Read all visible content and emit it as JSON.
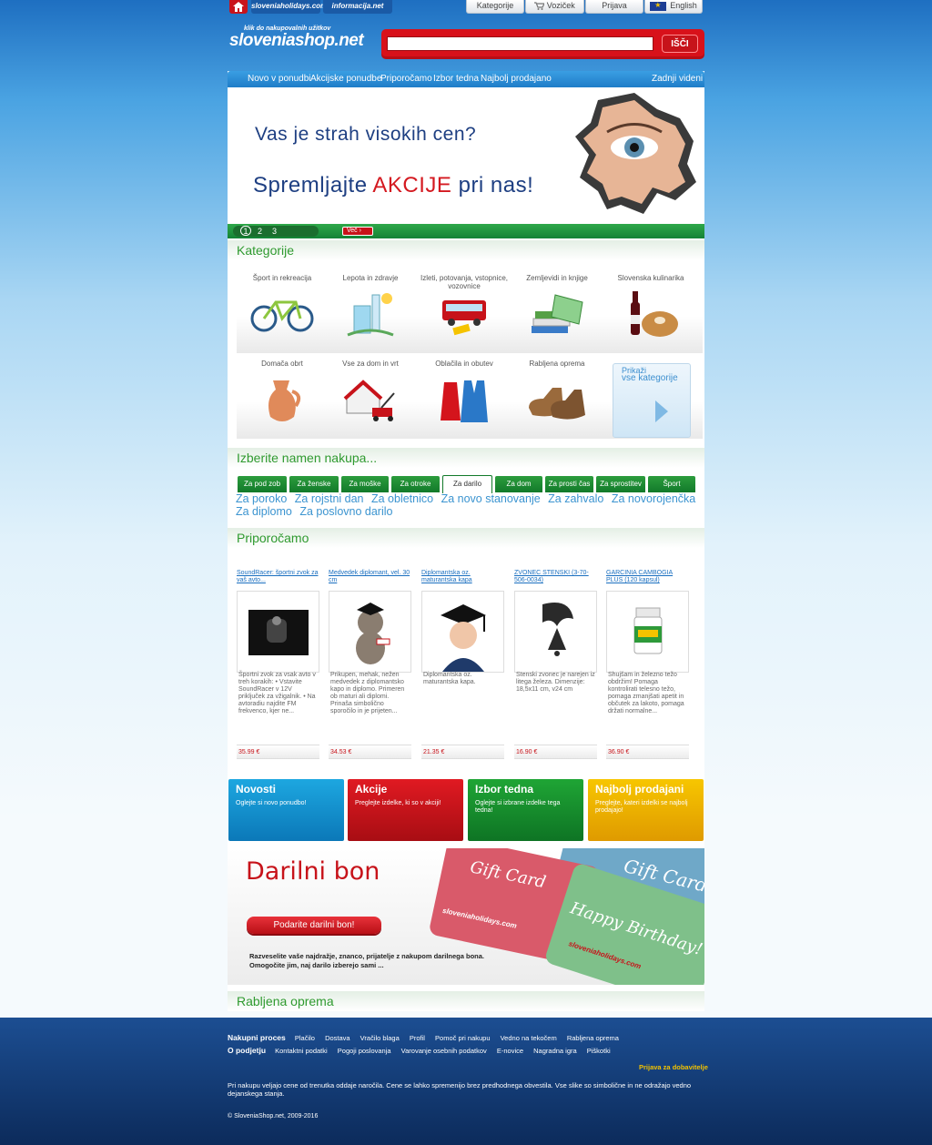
{
  "colors": {
    "brand_blue": "#1e6fc1",
    "accent_red": "#d8111a",
    "green": "#2f9a2f"
  },
  "topbar": {
    "home_icon": "house-icon",
    "site_tabs": [
      "sloveniaholidays.com",
      "informacija.net"
    ],
    "user_tabs": [
      {
        "label": "Kategorije"
      },
      {
        "label": "Voziček",
        "icon": "cart-icon"
      },
      {
        "label": "Prijava"
      },
      {
        "label": "English",
        "icon": "eu-flag-icon"
      }
    ]
  },
  "logo": {
    "tagline": "klik do nakupovalnih užitkov",
    "name": "sloveniashop.net"
  },
  "search": {
    "value": "",
    "button": "IŠČI"
  },
  "nav": {
    "items": [
      "Novo v ponudbi",
      "Akcijske ponudbe",
      "Priporočamo",
      "Izbor tedna",
      "Najbolj prodajano"
    ],
    "right": "Zadnji videni"
  },
  "banner": {
    "line1": "Vas je strah visokih cen?",
    "line2_a": "Spremljajte ",
    "line2_b": "AKCIJE",
    "line2_c": " pri nas!",
    "pages": [
      "1",
      "2",
      "3"
    ],
    "more": "Več"
  },
  "categories": {
    "title": "Kategorije",
    "items": [
      "Šport in rekreacija",
      "Lepota in zdravje",
      "Izleti, potovanja, vstopnice, vozovnice",
      "Zemljevidi in knjige",
      "Slovenska kulinarika",
      "Domača obrt",
      "Vse za dom in vrt",
      "Oblačila in obutev",
      "Rabljena oprema"
    ],
    "show_all_1": "Prikaži",
    "show_all_2": "vse kategorije"
  },
  "purpose": {
    "title": "Izberite namen nakupa...",
    "tabs": [
      "Za pod zob",
      "Za ženske",
      "Za moške",
      "Za otroke",
      "Za darilo",
      "Za dom",
      "Za prosti čas",
      "Za sprostitev",
      "Šport"
    ],
    "links": [
      "Za poroko",
      "Za rojstni dan",
      "Za obletnico",
      "Za novo stanovanje",
      "Za zahvalo",
      "Za novorojenčka",
      "Za diplomo",
      "Za poslovno darilo"
    ]
  },
  "recommend": {
    "title": "Priporočamo",
    "products": [
      {
        "title": "SoundRacer: športni zvok za vaš avto...",
        "desc": "Športni zvok za vsak avto v treh korakih: • Vstavite SoundRacer v 12V priključek za vžigalnik. • Na avtoradiu najdite FM frekvenco, kjer ne...",
        "price": "35.99 €"
      },
      {
        "title": "Medvedek diplomant, vel. 30 cm",
        "desc": "Prikupen, mehak, nežen medvedek z diplomantsko kapo in diplomo. Primeren ob maturi ali diplomi. Prinaša simbolično sporočilo in je prijeten...",
        "price": "34.53 €"
      },
      {
        "title": "Diplomantska oz. maturantska kapa",
        "desc": "Diplomantska oz. maturantska kapa.",
        "price": "21.35 €"
      },
      {
        "title": "ZVONEC STENSKI (3-70-506-0034)",
        "desc": "Stenski zvonec je narejen iz litega železa. Dimenzije: 18,5x11 cm, v24 cm",
        "price": "16.90 €"
      },
      {
        "title": "GARCINIA CAMBOGIA PLUS (120 kapsul)",
        "desc": "Shujšam in železno težo obdržim! Pomaga kontrolirati telesno težo, pomaga zmanjšati apetit in občutek za lakoto, pomaga držati normalne...",
        "price": "36.90 €"
      }
    ]
  },
  "promos": [
    {
      "title": "Novosti",
      "desc": "Oglejte si novo ponudbo!",
      "color": "#1d9bd8"
    },
    {
      "title": "Akcije",
      "desc": "Preglejte izdelke, ki so v akciji!",
      "color": "#d3141c"
    },
    {
      "title": "Izbor tedna",
      "desc": "Oglejte si izbrane izdelke tega tedna!",
      "color": "#16922e"
    },
    {
      "title": "Najbolj prodajani",
      "desc": "Preglejte, kateri izdelki se najbolj prodajajo!",
      "color": "#f1b800"
    }
  ],
  "gift": {
    "title": "Darilni bon",
    "button": "Podarite darilni bon!",
    "text": "Razveselite vaše najdražje, znanco, prijatelje z nakupom darilnega bona. Omogočite jim, naj darilo izberejo sami ...",
    "card1": "Gift Card",
    "card2": "Gift Card",
    "card3": "Happy Birthday!",
    "card_logo": "sloveniaholidays.com"
  },
  "used": {
    "title": "Rabljena oprema"
  },
  "footer": {
    "row1_label": "Nakupni proces",
    "row1": [
      "Plačilo",
      "Dostava",
      "Vračilo blaga",
      "Profil",
      "Pomoč pri nakupu",
      "Vedno na tekočem",
      "Rabljena oprema"
    ],
    "row2_label": "O podjetju",
    "row2": [
      "Kontaktni podatki",
      "Pogoji poslovanja",
      "Varovanje osebnih podatkov",
      "E-novice",
      "Nagradna igra",
      "Piškotki"
    ],
    "supplier": "Prijava za dobavitelje",
    "disclaimer": "Pri nakupu veljajo cene od trenutka oddaje naročila. Cene se lahko spremenijo brez predhodnega obvestila. Vse slike so simbolične in ne odražajo vedno dejanskega stanja.",
    "copyright": "© SloveniaShop.net, 2009-2016"
  }
}
